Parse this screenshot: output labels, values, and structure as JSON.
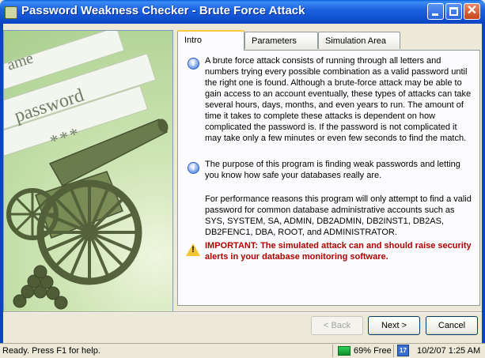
{
  "window": {
    "title": "Password Weakness Checker - Brute Force Attack",
    "close_glyph": "✕"
  },
  "illustration": {
    "texts": [
      "ame",
      "password",
      "***"
    ]
  },
  "tabs": [
    {
      "label": "Intro",
      "active": true
    },
    {
      "label": "Parameters",
      "active": false
    },
    {
      "label": "Simulation Area",
      "active": false
    }
  ],
  "intro": {
    "para1": "A brute force attack consists of running through all letters and numbers trying every possible combination as a valid password until the right one is found. Although a brute-force attack may be able to gain access to an account eventually, these types of attacks can take several hours, days, months, and even years to run. The amount of time it takes to complete these attacks is dependent on how complicated the password is. If the password is not complicated it may take only a few minutes or even few seconds to find the match.",
    "para2": "The purpose of this program is finding weak passwords and letting you know how safe your databases really are.",
    "para3": "For performance reasons this program will only attempt to find a valid password for common database administrative accounts such as SYS, SYSTEM, SA, ADMIN, DB2ADMIN, DB2INST1, DB2AS, DB2FENC1, DBA, ROOT, and ADMINISTRATOR.",
    "important": "IMPORTANT: The simulated attack can and should raise security alerts in your database monitoring software.",
    "info_glyph": "i",
    "warn_glyph": "!"
  },
  "buttons": {
    "back": "< Back",
    "next": "Next >",
    "cancel": "Cancel"
  },
  "status": {
    "text": "Ready. Press F1 for help.",
    "memory": "69% Free",
    "calendar_glyph": "17",
    "datetime": "10/2/07 1:25 AM"
  },
  "colors": {
    "title_bar": "#0b44c2",
    "important_text": "#b00000",
    "tab_highlight": "#ffc83c"
  },
  "icons": [
    "app-icon",
    "minimize-icon",
    "maximize-icon",
    "close-icon",
    "info-icon",
    "warning-icon",
    "memory-icon",
    "calendar-icon"
  ]
}
